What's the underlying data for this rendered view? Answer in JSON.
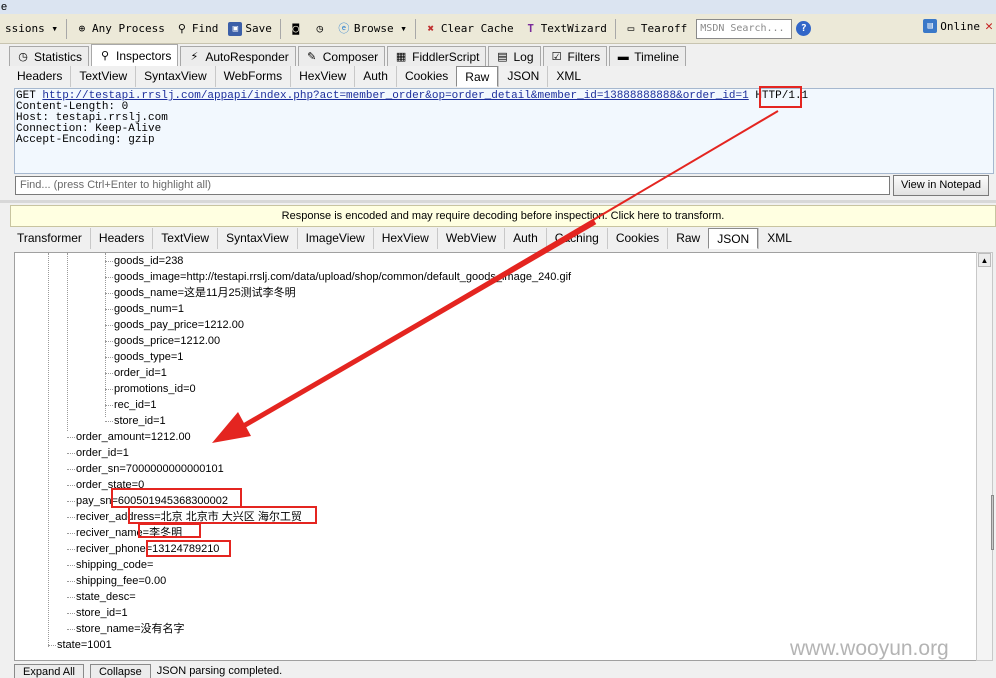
{
  "title_fragment": "e",
  "toolbar": {
    "sessions_label": "ssions ▾",
    "any_process": "Any Process",
    "find": "Find",
    "save": "Save",
    "browse": "Browse ▾",
    "clear_cache": "Clear Cache",
    "textwizard": "TextWizard",
    "tearoff": "Tearoff",
    "msdn_placeholder": "MSDN Search...",
    "online": "Online"
  },
  "main_tabs": [
    {
      "label": "Statistics",
      "icon": "stopwatch-icon"
    },
    {
      "label": "Inspectors",
      "icon": "inspectors-icon"
    },
    {
      "label": "AutoResponder",
      "icon": "lightning-icon"
    },
    {
      "label": "Composer",
      "icon": "composer-icon"
    },
    {
      "label": "FiddlerScript",
      "icon": "script-icon"
    },
    {
      "label": "Log",
      "icon": "log-icon"
    },
    {
      "label": "Filters",
      "icon": "checkbox-icon"
    },
    {
      "label": "Timeline",
      "icon": "timeline-icon"
    }
  ],
  "request_tabs": [
    "Headers",
    "TextView",
    "SyntaxView",
    "WebForms",
    "HexView",
    "Auth",
    "Cookies",
    "Raw",
    "JSON",
    "XML"
  ],
  "request_raw": {
    "method": "GET ",
    "url": "http://testapi.rrslj.com/appapi/index.php?act=member_order&op=order_detail&member_id=13888888888&order_id=1",
    "protocol": " HTTP/1.1",
    "line2": "Content-Length: 0",
    "line3": "Host: testapi.rrslj.com",
    "line4": "Connection: Keep-Alive",
    "line5": "Accept-Encoding: gzip"
  },
  "find": {
    "placeholder": "Find... (press Ctrl+Enter to highlight all)",
    "view_notepad": "View in Notepad"
  },
  "response_notice": "Response is encoded and may require decoding before inspection. Click here to transform.",
  "response_tabs": [
    "Transformer",
    "Headers",
    "TextView",
    "SyntaxView",
    "ImageView",
    "HexView",
    "WebView",
    "Auth",
    "Caching",
    "Cookies",
    "Raw",
    "JSON",
    "XML"
  ],
  "tree": {
    "goods": [
      "goods_id=238",
      "goods_image=http://testapi.rrslj.com/data/upload/shop/common/default_goods_image_240.gif",
      "goods_name=这是11月25测试李冬明",
      "goods_num=1",
      "goods_pay_price=1212.00",
      "goods_price=1212.00",
      "goods_type=1",
      "order_id=1",
      "promotions_id=0",
      "rec_id=1",
      "store_id=1"
    ],
    "order": [
      "order_amount=1212.00",
      "order_id=1",
      "order_sn=7000000000000101",
      "order_state=0",
      "pay_sn=600501945368300002",
      "reciver_address=北京 北京市 大兴区 海尔工贸",
      "reciver_name=李冬明",
      "reciver_phone=13124789210",
      "shipping_code=",
      "shipping_fee=0.00",
      "state_desc=",
      "store_id=1",
      "store_name=没有名字"
    ],
    "root": "state=1001"
  },
  "status": {
    "expand_all": "Expand All",
    "collapse": "Collapse",
    "message": "JSON parsing completed."
  },
  "watermark": "www.wooyun.org",
  "colors": {
    "highlight": "#e42520",
    "arrow": "#e42520"
  }
}
